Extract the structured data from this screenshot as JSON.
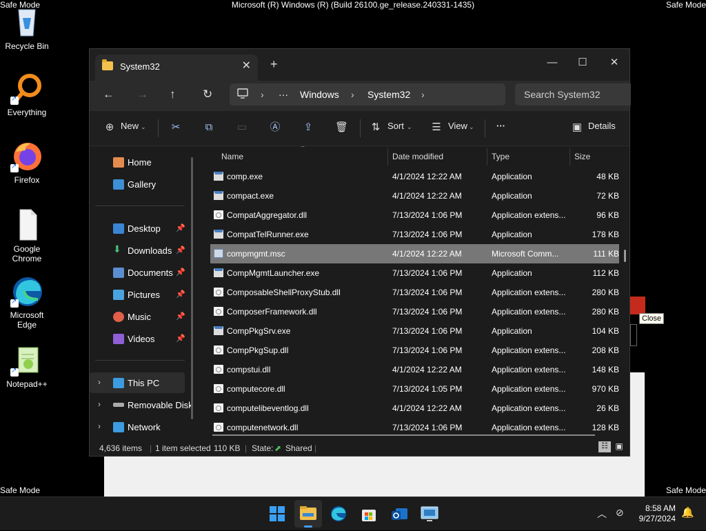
{
  "screen": {
    "safe_mode_label": "Safe Mode",
    "build_text": "Microsoft (R) Windows (R) (Build 26100.ge_release.240331-1435)"
  },
  "desktop_icons": [
    {
      "label": "Recycle Bin"
    },
    {
      "label": "Everything"
    },
    {
      "label": "Firefox"
    },
    {
      "label": "Google Chrome"
    },
    {
      "label": "Microsoft Edge"
    },
    {
      "label": "Notepad++"
    }
  ],
  "window": {
    "tab_title": "System32",
    "close_tab": "✕",
    "new_tab": "+",
    "minimize": "—",
    "maximize": "☐",
    "close": "✕"
  },
  "address": {
    "ellipsis": "···",
    "crumbs": [
      "Windows",
      "System32"
    ],
    "search_placeholder": "Search System32"
  },
  "commands": {
    "new": "New",
    "sort": "Sort",
    "view": "View",
    "more": "···",
    "details": "Details"
  },
  "nav": {
    "home": "Home",
    "gallery": "Gallery",
    "quick": [
      {
        "label": "Desktop"
      },
      {
        "label": "Downloads"
      },
      {
        "label": "Documents"
      },
      {
        "label": "Pictures"
      },
      {
        "label": "Music"
      },
      {
        "label": "Videos"
      }
    ],
    "this_pc": "This PC",
    "removable": "Removable Disk",
    "network": "Network"
  },
  "columns": {
    "name": "Name",
    "date": "Date modified",
    "type": "Type",
    "size": "Size"
  },
  "files": [
    {
      "name": "comp.exe",
      "date": "4/1/2024 12:22 AM",
      "type": "Application",
      "size": "48 KB",
      "kind": "exe"
    },
    {
      "name": "compact.exe",
      "date": "4/1/2024 12:22 AM",
      "type": "Application",
      "size": "72 KB",
      "kind": "exe"
    },
    {
      "name": "CompatAggregator.dll",
      "date": "7/13/2024 1:06 PM",
      "type": "Application extens...",
      "size": "96 KB",
      "kind": "dll"
    },
    {
      "name": "CompatTelRunner.exe",
      "date": "7/13/2024 1:06 PM",
      "type": "Application",
      "size": "178 KB",
      "kind": "exe"
    },
    {
      "name": "compmgmt.msc",
      "date": "4/1/2024 12:22 AM",
      "type": "Microsoft Comm...",
      "size": "111 KB",
      "kind": "msc",
      "selected": true
    },
    {
      "name": "CompMgmtLauncher.exe",
      "date": "7/13/2024 1:06 PM",
      "type": "Application",
      "size": "112 KB",
      "kind": "exe"
    },
    {
      "name": "ComposableShellProxyStub.dll",
      "date": "7/13/2024 1:06 PM",
      "type": "Application extens...",
      "size": "280 KB",
      "kind": "dll"
    },
    {
      "name": "ComposerFramework.dll",
      "date": "7/13/2024 1:06 PM",
      "type": "Application extens...",
      "size": "280 KB",
      "kind": "dll"
    },
    {
      "name": "CompPkgSrv.exe",
      "date": "7/13/2024 1:06 PM",
      "type": "Application",
      "size": "104 KB",
      "kind": "exe"
    },
    {
      "name": "CompPkgSup.dll",
      "date": "7/13/2024 1:06 PM",
      "type": "Application extens...",
      "size": "208 KB",
      "kind": "dll"
    },
    {
      "name": "compstui.dll",
      "date": "4/1/2024 12:22 AM",
      "type": "Application extens...",
      "size": "148 KB",
      "kind": "dll"
    },
    {
      "name": "computecore.dll",
      "date": "7/13/2024 1:05 PM",
      "type": "Application extens...",
      "size": "970 KB",
      "kind": "dll"
    },
    {
      "name": "computelibeventlog.dll",
      "date": "4/1/2024 12:22 AM",
      "type": "Application extens...",
      "size": "26 KB",
      "kind": "dll"
    },
    {
      "name": "computenetwork.dll",
      "date": "7/13/2024 1:06 PM",
      "type": "Application extens...",
      "size": "128 KB",
      "kind": "dll"
    }
  ],
  "status": {
    "items": "4,636 items",
    "selected": "1 item selected",
    "size": "110 KB",
    "state_label": "State:",
    "state_value": "Shared"
  },
  "tooltip": "Close",
  "clock": {
    "time": "8:58 AM",
    "date": "9/27/2024"
  },
  "colors": {
    "accent": "#4a9eff",
    "selected_row": "#777777",
    "window_bg": "#1c1c1c"
  }
}
